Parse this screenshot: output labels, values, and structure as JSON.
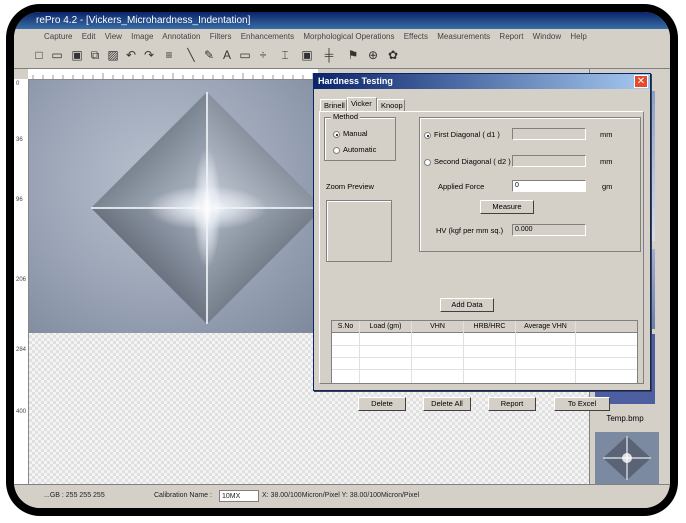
{
  "window": {
    "title": "rePro 4.2 - [Vickers_Microhardness_Indentation]"
  },
  "menu": [
    "Capture",
    "Edit",
    "View",
    "Image",
    "Annotation",
    "Filters",
    "Enhancements",
    "Morphological Operations",
    "Effects",
    "Measurements",
    "Report",
    "Window",
    "Help"
  ],
  "toolbar_icons": [
    "new-file-icon",
    "open-folder-icon",
    "capture-icon",
    "copy-icon",
    "image-icon",
    "undo-icon",
    "redo-icon",
    "filter-icon",
    "line-icon",
    "pencil-icon",
    "text-icon",
    "rectangle-icon",
    "crosshair-icon",
    "measure-icon",
    "display-icon",
    "split-icon",
    "brush-icon",
    "zoom-icon",
    "settings-icon"
  ],
  "ruler": {
    "left_marks": [
      "0",
      "36",
      "96",
      "206",
      "284",
      "400"
    ]
  },
  "dialog": {
    "title": "Hardness Testing",
    "close_label": "✕",
    "tabs": [
      "Brinell",
      "Vicker",
      "Knoop"
    ],
    "active_tab": "Vicker",
    "method": {
      "legend": "Method",
      "manual": "Manual",
      "automatic": "Automatic",
      "selected": "Manual"
    },
    "zoom_preview_label": "Zoom Preview",
    "first_diagonal": {
      "label": "First Diagonal ( d1 )",
      "value": "",
      "unit": "mm"
    },
    "second_diagonal": {
      "label": "Second Diagonal ( d2 )",
      "value": "",
      "unit": "mm"
    },
    "applied_force": {
      "label": "Applied Force",
      "value": "0",
      "unit": "gm"
    },
    "measure_button": "Measure",
    "hv": {
      "label": "HV (kgf per mm sq.)",
      "value": "0.000"
    },
    "add_data_button": "Add Data",
    "table": {
      "columns": [
        "S.No",
        "Load (gm)",
        "VHN",
        "HRB/HRC",
        "Average VHN"
      ],
      "rows": []
    },
    "buttons": {
      "delete": "Delete",
      "delete_all": "Delete All",
      "report": "Report",
      "to_excel": "To Excel"
    }
  },
  "right_panel": {
    "thumbnail_label": "Temp.bmp"
  },
  "status": {
    "rgb": "...GB : 255 255 255",
    "calibration_label": "Calibration Name :",
    "calibration_value": "10MX",
    "scale": "X: 38.00/100Micron/Pixel Y: 38.00/100Micron/Pixel"
  },
  "colors": {
    "title_bar": "#0a246a",
    "dialog_bg": "#d4d0c8",
    "close_button": "#e44a2b"
  }
}
